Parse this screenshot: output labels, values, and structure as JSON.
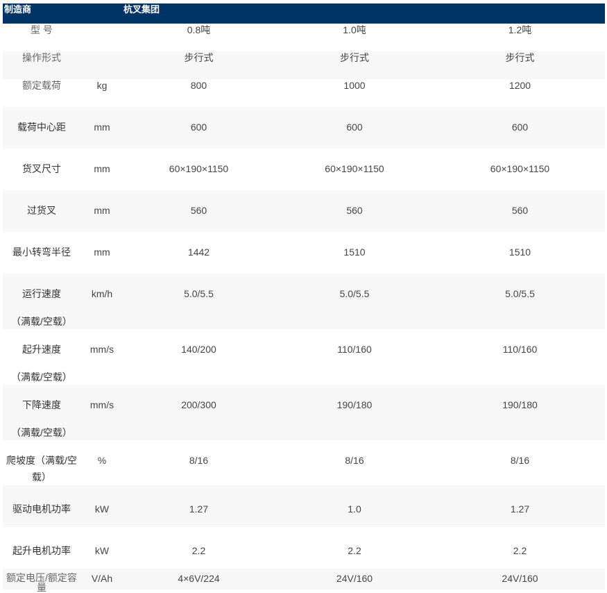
{
  "header": {
    "label": "制造商",
    "value": "杭叉集团"
  },
  "rows": [
    {
      "name": [
        "型 号"
      ],
      "unit": "",
      "v1": "0.8吨",
      "v2": "1.0吨",
      "v3": "1.2吨"
    },
    {
      "name": [
        "操作形式"
      ],
      "unit": "",
      "v1": "步行式",
      "v2": "步行式",
      "v3": "步行式"
    },
    {
      "name": [
        "额定载荷"
      ],
      "unit": "kg",
      "v1": "800",
      "v2": "1000",
      "v3": "1200"
    },
    {
      "name": [
        "载荷中心距"
      ],
      "unit": "mm",
      "v1": "600",
      "v2": "600",
      "v3": "600"
    },
    {
      "name": [
        "货叉尺寸"
      ],
      "unit": "mm",
      "v1": "60×190×1150",
      "v2": "60×190×1150",
      "v3": "60×190×1150"
    },
    {
      "name": [
        "过货叉"
      ],
      "unit": "mm",
      "v1": "560",
      "v2": "560",
      "v3": "560"
    },
    {
      "name": [
        "最小转弯半径"
      ],
      "unit": "mm",
      "v1": "1442",
      "v2": "1510",
      "v3": "1510"
    },
    {
      "name": [
        "运行速度",
        "（满载/空载）"
      ],
      "unit": "km/h",
      "v1": "5.0/5.5",
      "v2": "5.0/5.5",
      "v3": "5.0/5.5"
    },
    {
      "name": [
        "起升速度",
        "（满载/空载）"
      ],
      "unit": "mm/s",
      "v1": "140/200",
      "v2": "110/160",
      "v3": "110/160"
    },
    {
      "name": [
        "下降速度",
        "（满载/空载）"
      ],
      "unit": "mm/s",
      "v1": "200/300",
      "v2": "190/180",
      "v3": "190/180"
    },
    {
      "name": [
        "爬坡度（满载/空",
        "载）"
      ],
      "unit": "%",
      "v1": "8/16",
      "v2": "8/16",
      "v3": "8/16"
    },
    {
      "name": [
        "驱动电机功率"
      ],
      "unit": "kW",
      "v1": "1.27",
      "v2": "1.0",
      "v3": "1.27"
    },
    {
      "name": [
        "起升电机功率"
      ],
      "unit": "kW",
      "v1": "2.2",
      "v2": "2.2",
      "v3": "2.2"
    },
    {
      "name": [
        "额定电压/额定容",
        "量"
      ],
      "unit": "V/Ah",
      "v1": "4×6V/224",
      "v2": "24V/160",
      "v3": "24V/160"
    }
  ]
}
